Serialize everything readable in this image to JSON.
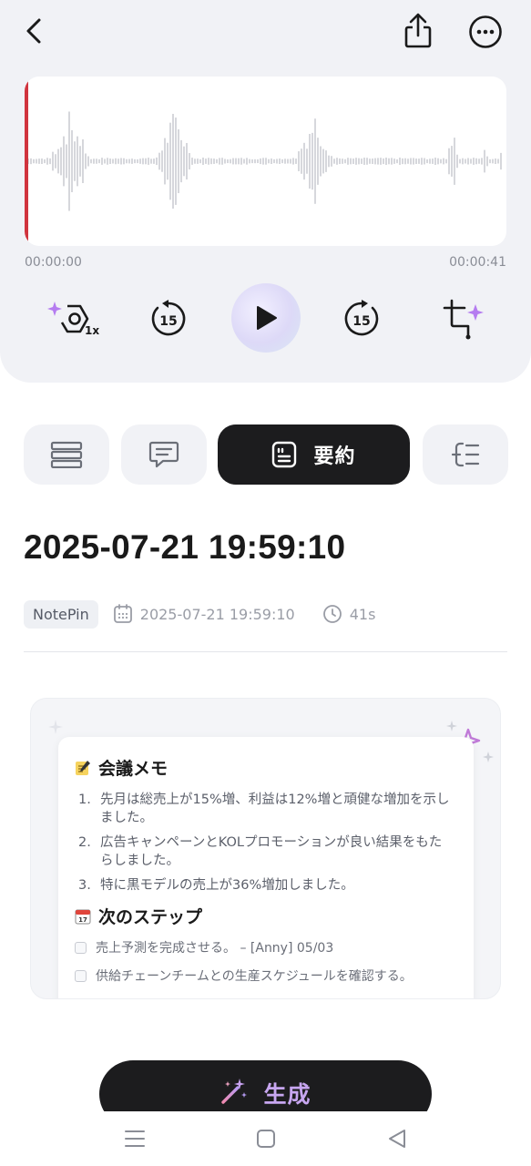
{
  "player": {
    "time_start": "00:00:00",
    "time_end": "00:00:41",
    "progress": 0,
    "speed_label": "1x",
    "skip_back_label": "15",
    "skip_forward_label": "15"
  },
  "tabs": [
    {
      "icon": "list-icon",
      "label": ""
    },
    {
      "icon": "chat-icon",
      "label": ""
    },
    {
      "icon": "summary-icon",
      "label": "要約",
      "active": true
    },
    {
      "icon": "mindmap-icon",
      "label": ""
    }
  ],
  "recording": {
    "title": "2025-07-21 19:59:10",
    "badge": "NotePin",
    "date": "2025-07-21 19:59:10",
    "duration": "41s"
  },
  "preview": {
    "section1_title": "会議メモ",
    "notes": [
      {
        "num": "1.",
        "text": "先月は総売上が15%増、利益は12%増と頑健な増加を示しました。"
      },
      {
        "num": "2.",
        "text": "広告キャンペーンとKOLプロモーションが良い結果をもたらしました。"
      },
      {
        "num": "3.",
        "text": "特に黒モデルの売上が36%増加しました。"
      }
    ],
    "section2_title": "次のステップ",
    "steps": [
      "売上予測を完成させる。 – [Anny] 05/03",
      "供給チェーンチームとの生産スケジュールを確認する。"
    ]
  },
  "generate_button": {
    "label": "生成"
  },
  "colors": {
    "accent_purple": "#c7a6f0",
    "playhead": "#d0343e",
    "dark": "#1c1c1e"
  }
}
